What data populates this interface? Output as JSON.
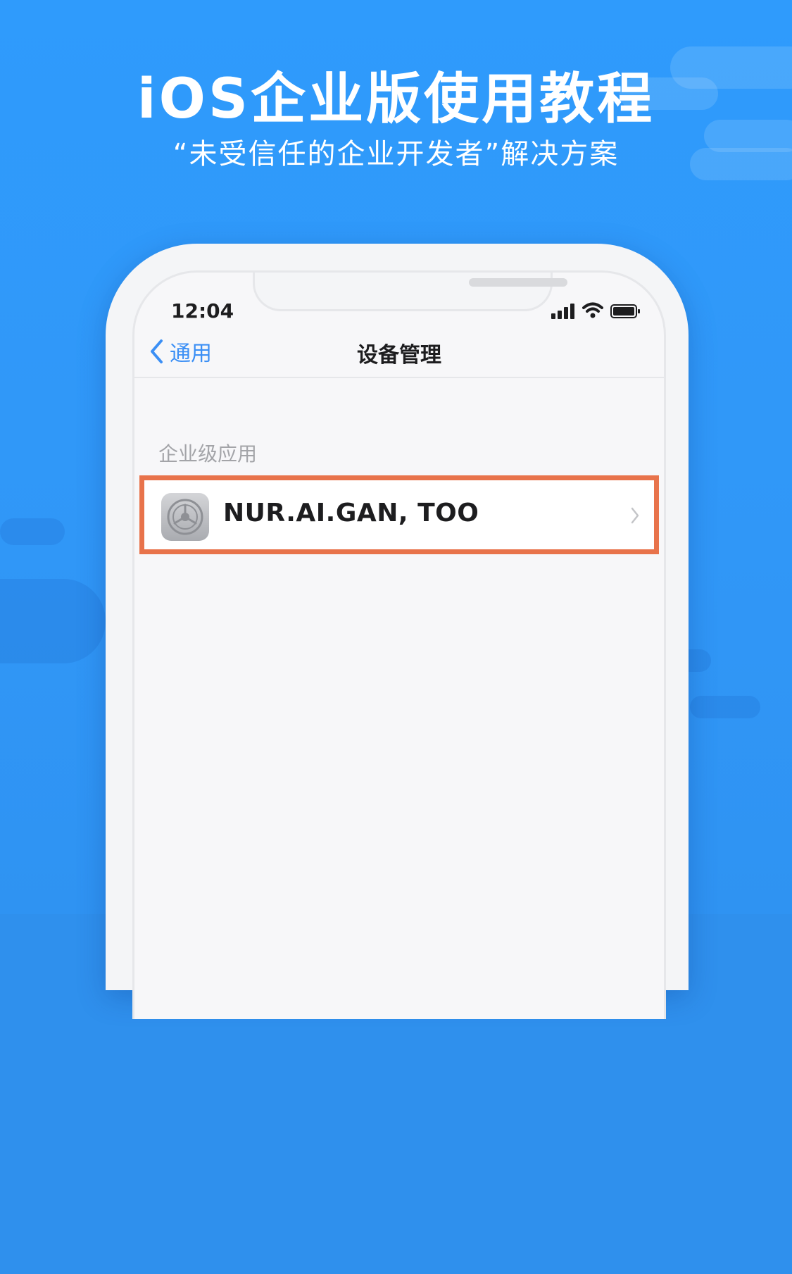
{
  "header": {
    "title": "iOS企业版使用教程",
    "subtitle": "“未受信任的企业开发者”解决方案"
  },
  "status_bar": {
    "time": "12:04",
    "icons": [
      "signal-icon",
      "wifi-icon",
      "battery-icon"
    ]
  },
  "navbar": {
    "back_label": "通用",
    "title": "设备管理"
  },
  "section": {
    "header": "企业级应用",
    "items": [
      {
        "icon": "settings-gear-icon",
        "label": "NUR.AI.GAN, TOO"
      }
    ]
  },
  "colors": {
    "background": "#2f98f6",
    "highlight_border": "#e8734b",
    "link": "#3b8ff5"
  }
}
